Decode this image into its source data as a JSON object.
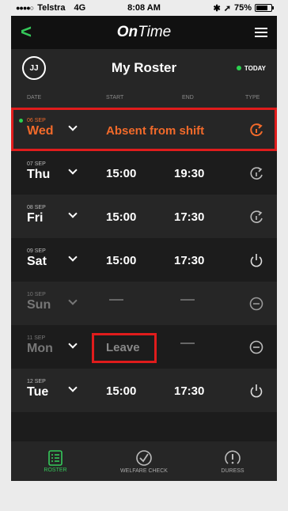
{
  "status": {
    "carrier": "Telstra",
    "network": "4G",
    "time": "8:08 AM",
    "battery": "75%",
    "battery_fraction": 0.75
  },
  "nav": {
    "brand_bold": "On",
    "brand_rest": "Time"
  },
  "header": {
    "avatar_initials": "JJ",
    "title": "My Roster",
    "today_label": "TODAY"
  },
  "columns": {
    "date": "DATE",
    "start": "START",
    "end": "END",
    "type": "TYPE"
  },
  "rows": [
    {
      "date": "06 SEP",
      "day": "Wed",
      "status": "Absent from shift",
      "type_icon": "absent-icon"
    },
    {
      "date": "07 SEP",
      "day": "Thu",
      "start": "15:00",
      "end": "19:30",
      "type_icon": "refresh-icon"
    },
    {
      "date": "08 SEP",
      "day": "Fri",
      "start": "15:00",
      "end": "17:30",
      "type_icon": "refresh-icon"
    },
    {
      "date": "09 SEP",
      "day": "Sat",
      "start": "15:00",
      "end": "17:30",
      "type_icon": "power-icon"
    },
    {
      "date": "10 SEP",
      "day": "Sun",
      "start": "",
      "end": "",
      "type_icon": "minus-circle-icon"
    },
    {
      "date": "11 SEP",
      "day": "Mon",
      "status": "Leave",
      "end": "",
      "type_icon": "minus-circle-icon"
    },
    {
      "date": "12 SEP",
      "day": "Tue",
      "start": "15:00",
      "end": "17:30",
      "type_icon": "power-icon"
    }
  ],
  "tabs": {
    "roster": "ROSTER",
    "welfare": "WELFARE CHECK",
    "duress": "DURESS"
  },
  "colors": {
    "accent_green": "#35c85a",
    "highlight_red": "#e01c1c",
    "absent_orange": "#f26a2a"
  }
}
